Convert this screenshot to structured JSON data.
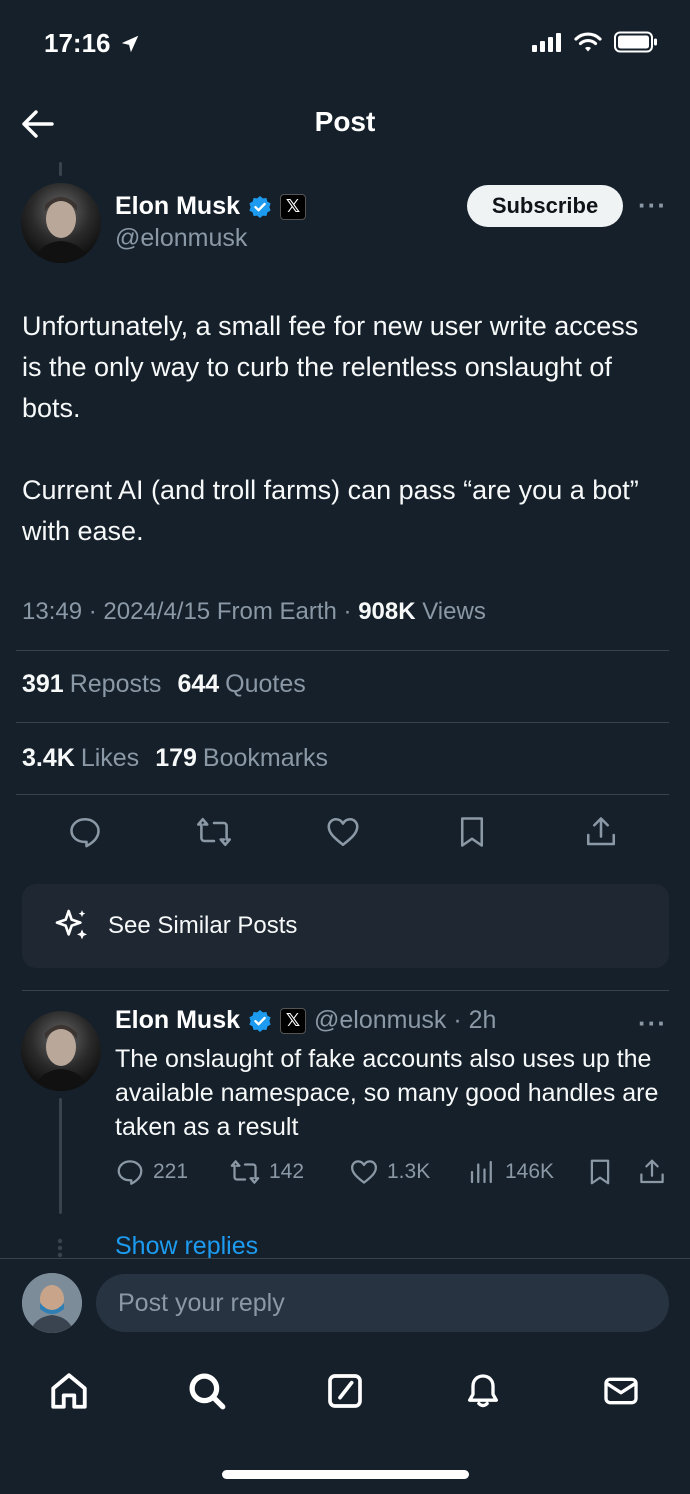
{
  "status_bar": {
    "time": "17:16",
    "icons": [
      "location-arrow-icon",
      "signal-icon",
      "wifi-icon",
      "battery-icon"
    ]
  },
  "header": {
    "title": "Post",
    "back_icon": "arrow-left-icon"
  },
  "post": {
    "author_name": "Elon Musk",
    "handle": "@elonmusk",
    "subscribe_label": "Subscribe",
    "more_label": "···",
    "body_paragraphs": [
      "Unfortunately, a small fee for new user write access is the only way to curb the relentless onslaught of bots.",
      "Current AI (and troll farms) can pass “are you a bot” with ease."
    ],
    "meta_prefix": "13:49 · 2024/4/15 From Earth · ",
    "views_count": "908K",
    "views_label": " Views",
    "reposts_count": "391",
    "reposts_label": "Reposts",
    "quotes_count": "644",
    "quotes_label": "Quotes",
    "likes_count": "3.4K",
    "likes_label": "Likes",
    "bookmarks_count": "179",
    "bookmarks_label": "Bookmarks"
  },
  "similar": {
    "label": "See Similar Posts"
  },
  "reply": {
    "author_name": "Elon Musk",
    "handle_time": "@elonmusk · 2h",
    "more_label": "···",
    "text": "The onslaught of fake accounts also uses up the available namespace, so many good handles are taken as a result",
    "replies": "221",
    "reposts": "142",
    "likes": "1.3K",
    "views": "146K",
    "show_replies": "Show replies"
  },
  "composer": {
    "placeholder": "Post your reply"
  },
  "tabbar": {
    "items": [
      "home-icon",
      "search-icon",
      "compose-icon",
      "notifications-icon",
      "messages-icon"
    ]
  },
  "colors": {
    "background": "#15202b",
    "accent": "#1d9bf0",
    "muted": "#8b98a5",
    "divider": "#38444d"
  }
}
